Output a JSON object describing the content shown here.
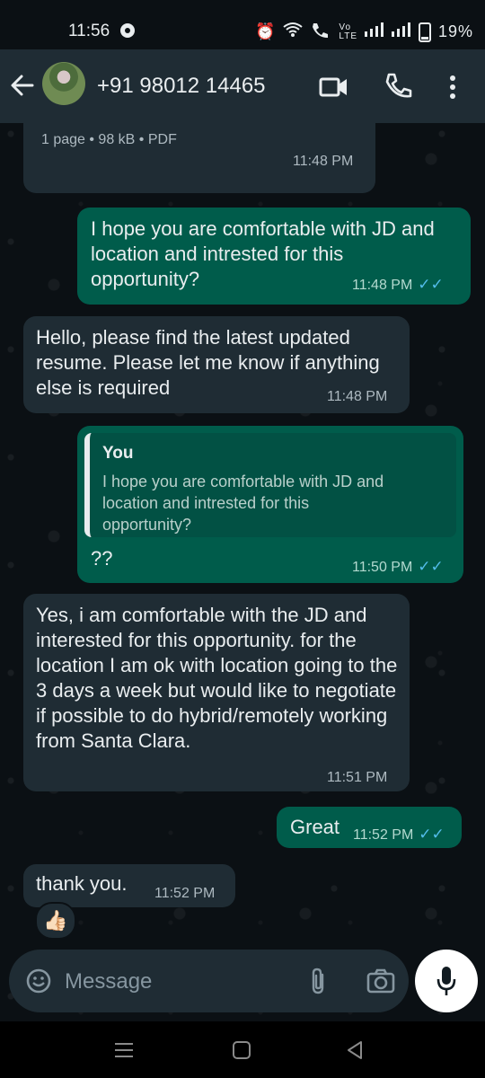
{
  "status_bar": {
    "time": "11:56",
    "battery": "19%"
  },
  "header": {
    "contact": "+91 98012 14465"
  },
  "messages": [
    {
      "type": "document",
      "direction": "incoming",
      "meta": "1 page • 98 kB • PDF",
      "time": "11:48 PM"
    },
    {
      "type": "text",
      "direction": "outgoing",
      "text": "I hope you are comfortable with JD and location and intrested for this opportunity?",
      "time": "11:48 PM",
      "read": true
    },
    {
      "type": "text",
      "direction": "incoming",
      "text": "Hello, please find the latest updated resume. Please let me know if anything else is required",
      "time": "11:48 PM"
    },
    {
      "type": "reply",
      "direction": "outgoing",
      "quoted_author": "You",
      "quoted_text": "I hope you are comfortable with JD and location and intrested for this opportunity?",
      "text": "??",
      "time": "11:50 PM",
      "read": true
    },
    {
      "type": "text",
      "direction": "incoming",
      "text": "Yes, i am comfortable with the JD and interested for this opportunity. for the location I am ok with location going to the 3 days a week but would like to negotiate if possible to do hybrid/remotely working from Santa Clara.",
      "time": "11:51 PM"
    },
    {
      "type": "text",
      "direction": "outgoing",
      "text": "Great",
      "time": "11:52 PM",
      "read": true
    },
    {
      "type": "text",
      "direction": "incoming",
      "text": "thank you.",
      "time": "11:52 PM",
      "reaction": "👍🏻"
    }
  ],
  "composer": {
    "placeholder": "Message"
  },
  "icons": {
    "back": "back-arrow-icon",
    "video": "video-call-icon",
    "call": "phone-call-icon",
    "menu": "more-vertical-icon",
    "emoji": "sticker-emoji-icon",
    "attach": "paperclip-icon",
    "camera": "camera-icon",
    "mic": "microphone-icon"
  },
  "colors": {
    "incoming_bubble": "#1f2c34",
    "outgoing_bubble": "#005c4b",
    "read_ticks": "#53bdeb",
    "background": "#0b1014"
  }
}
